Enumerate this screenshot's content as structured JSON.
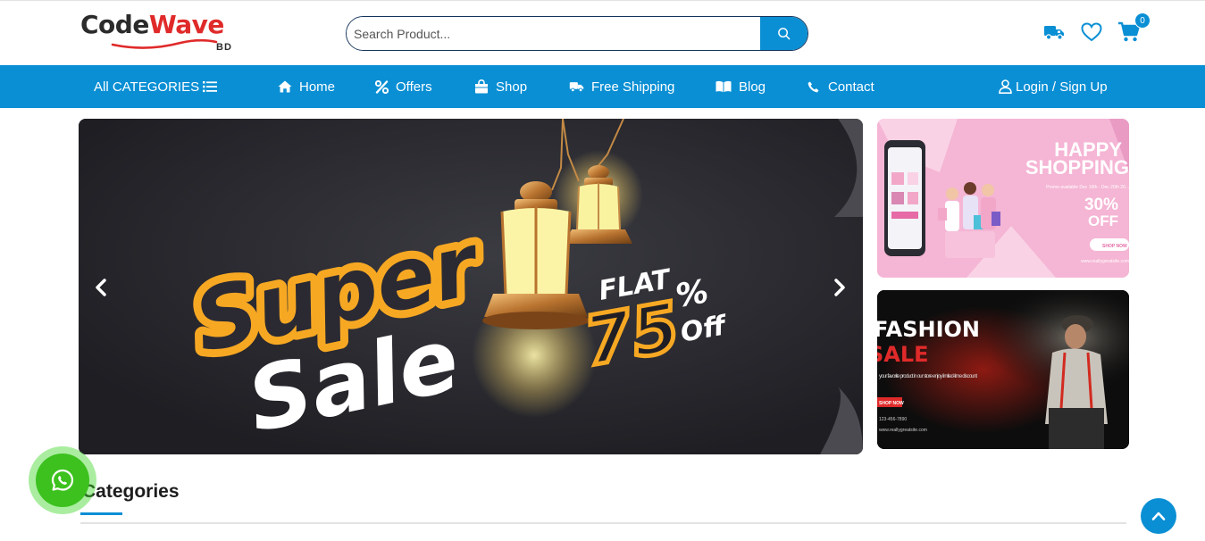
{
  "brand": {
    "name_part1": "Code",
    "name_part2": "Wave",
    "suffix": "BD",
    "colors": {
      "dark": "#2b2b2b",
      "accent": "#e02a2a"
    }
  },
  "search": {
    "placeholder": "Search Product...",
    "value": "",
    "button_icon": "search-icon"
  },
  "header_icons": {
    "items": [
      {
        "name": "truck-icon"
      },
      {
        "name": "heart-icon"
      },
      {
        "name": "cart-icon"
      }
    ],
    "cart_count": "0"
  },
  "nav": {
    "all_categories": "All CATEGORIES",
    "items": [
      {
        "label": "Home",
        "icon": "home-icon"
      },
      {
        "label": "Offers",
        "icon": "percent-icon"
      },
      {
        "label": "Shop",
        "icon": "shopping-bag-icon"
      },
      {
        "label": "Free Shipping",
        "icon": "truck-icon"
      },
      {
        "label": "Blog",
        "icon": "book-icon"
      },
      {
        "label": "Contact",
        "icon": "phone-icon"
      }
    ],
    "login": "Login / Sign Up"
  },
  "hero": {
    "banner_word1": "Super",
    "banner_word2": "Sale",
    "flat": "FLAT",
    "discount": "75",
    "percent": "%",
    "off": "Off",
    "prev_icon": "chevron-left-icon",
    "next_icon": "chevron-right-icon"
  },
  "side_banner_1": {
    "title_line1": "HAPPY",
    "title_line2": "SHOPPING",
    "promo": "Promo available Dec 10th - Dec 20th 20...",
    "discount": "30%",
    "off": "OFF",
    "button": "SHOP NOW",
    "url": "www.reallygreatsite.com"
  },
  "side_banner_2": {
    "title_line1": "FASHION",
    "title_line2": "SALE",
    "desc": "your favorite product in our store enjoy limited-time discount",
    "button": "SHOP NOW",
    "phone": "123-456-7890",
    "url": "www.reallygreatsite.com"
  },
  "categories": {
    "title": "Categories"
  },
  "theme": {
    "primary": "#0a8fd4",
    "whatsapp": "#3cc11e"
  }
}
